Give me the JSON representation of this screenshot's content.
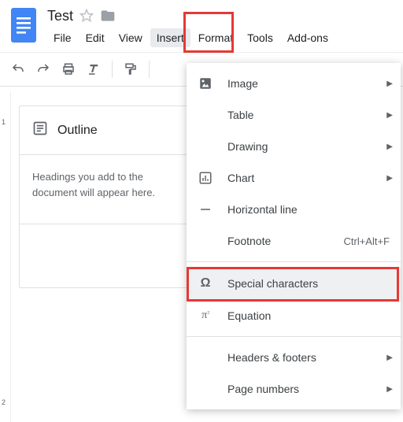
{
  "doc": {
    "title": "Test",
    "menus": {
      "file": "File",
      "edit": "Edit",
      "view": "View",
      "insert": "Insert",
      "format": "Format",
      "tools": "Tools",
      "addons": "Add-ons"
    }
  },
  "outline": {
    "title": "Outline",
    "hint": "Headings you add to the document will appear here."
  },
  "ruler": {
    "tick1": "1",
    "tick2": "2"
  },
  "insertMenu": {
    "image": "Image",
    "table": "Table",
    "drawing": "Drawing",
    "chart": "Chart",
    "hline": "Horizontal line",
    "footnote": "Footnote",
    "footnote_shortcut": "Ctrl+Alt+F",
    "special": "Special characters",
    "equation": "Equation",
    "headersfooters": "Headers & footers",
    "pagenumbers": "Page numbers"
  }
}
